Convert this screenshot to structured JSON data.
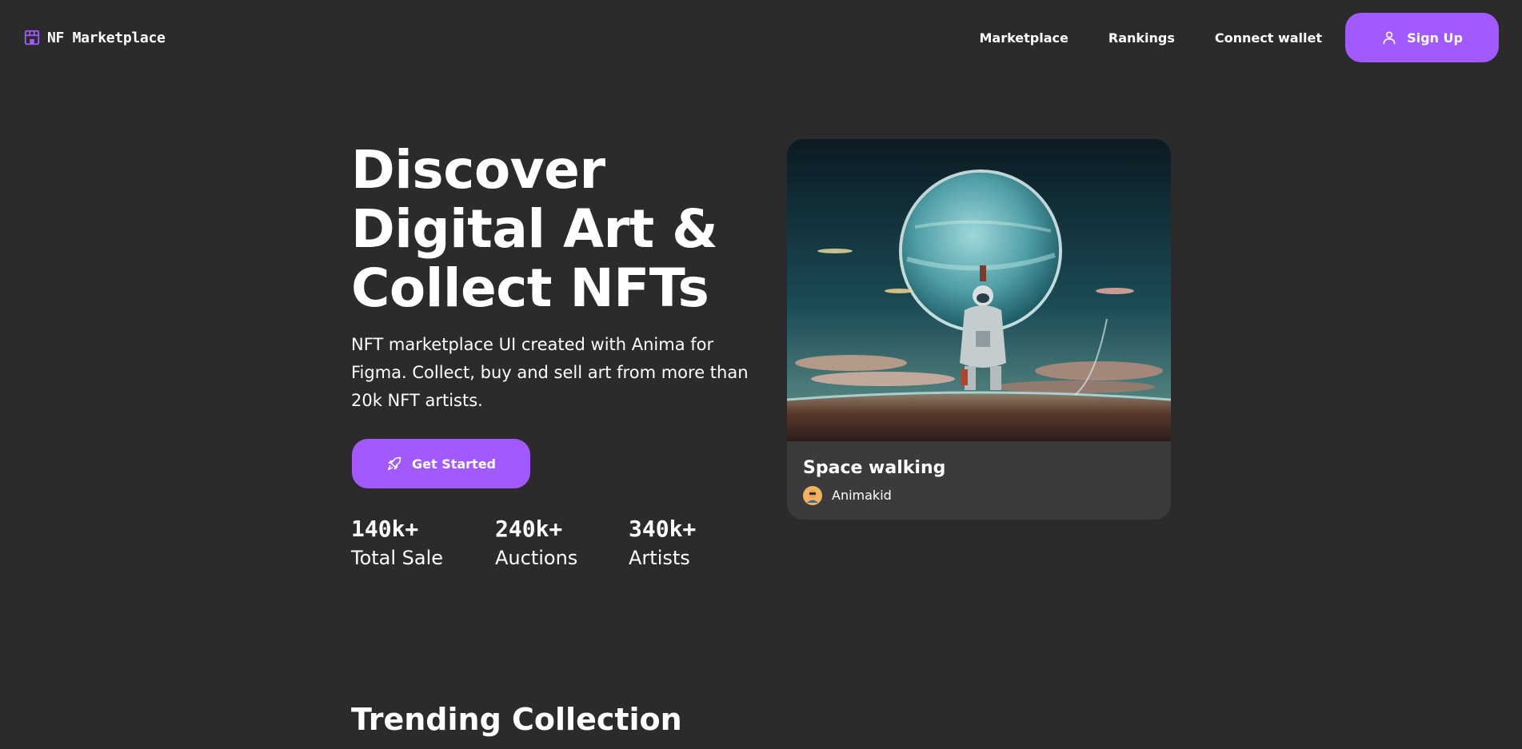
{
  "header": {
    "logo_icon": "storefront-icon",
    "logo_text": "NF Marketplace",
    "nav": [
      {
        "label": "Marketplace"
      },
      {
        "label": "Rankings"
      },
      {
        "label": "Connect wallet"
      }
    ],
    "signup": {
      "label": "Sign Up",
      "icon": "user-icon"
    }
  },
  "hero": {
    "title_lines": [
      "Discover",
      "Digital Art &",
      "Collect NFTs"
    ],
    "description": "NFT marketplace UI created with Anima for Figma. Collect, buy and sell art from more than 20k NFT artists.",
    "cta": {
      "label": "Get Started",
      "icon": "rocket-icon"
    },
    "stats": [
      {
        "value": "140k+",
        "label": "Total Sale"
      },
      {
        "value": "240k+",
        "label": "Auctions"
      },
      {
        "value": "340k+",
        "label": "Artists"
      }
    ]
  },
  "featured_card": {
    "image": "astronaut-planet-artwork",
    "title": "Space walking",
    "artist": {
      "name": "Animakid",
      "avatar": "artist-avatar"
    }
  },
  "trending": {
    "title": "Trending Collection"
  },
  "colors": {
    "background": "#2b2b2b",
    "accent": "#a259ff",
    "card": "#3b3b3b",
    "text": "#ffffff"
  }
}
